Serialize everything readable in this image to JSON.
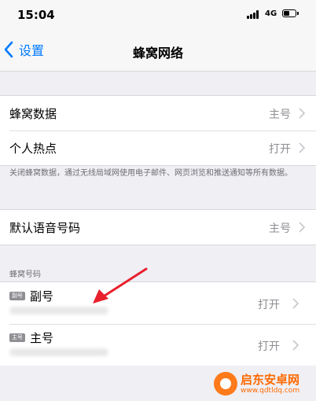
{
  "status_bar": {
    "time": "15:04",
    "network": "4G"
  },
  "nav": {
    "back_label": "设置",
    "title": "蜂窝网络"
  },
  "group1": [
    {
      "label": "蜂窝数据",
      "value": "主号"
    },
    {
      "label": "个人热点",
      "value": "打开"
    }
  ],
  "footnote": "关闭蜂窝数据，通过无线局域网使用电子邮件、网页浏览和推送通知等所有数据。",
  "group2": [
    {
      "label": "默认语音号码",
      "value": "主号"
    }
  ],
  "sim_section": {
    "header": "蜂窝号码",
    "items": [
      {
        "badge": "副号",
        "name": "副号",
        "value": "打开"
      },
      {
        "badge": "主号",
        "name": "主号",
        "value": "打开"
      }
    ]
  },
  "watermark": {
    "title": "启东安卓网",
    "url": "www.qdtldq.com"
  },
  "colors": {
    "accent": "#007aff",
    "arrow": "#e8212d",
    "watermark": "#ff6a00",
    "background": "#efeff4"
  }
}
